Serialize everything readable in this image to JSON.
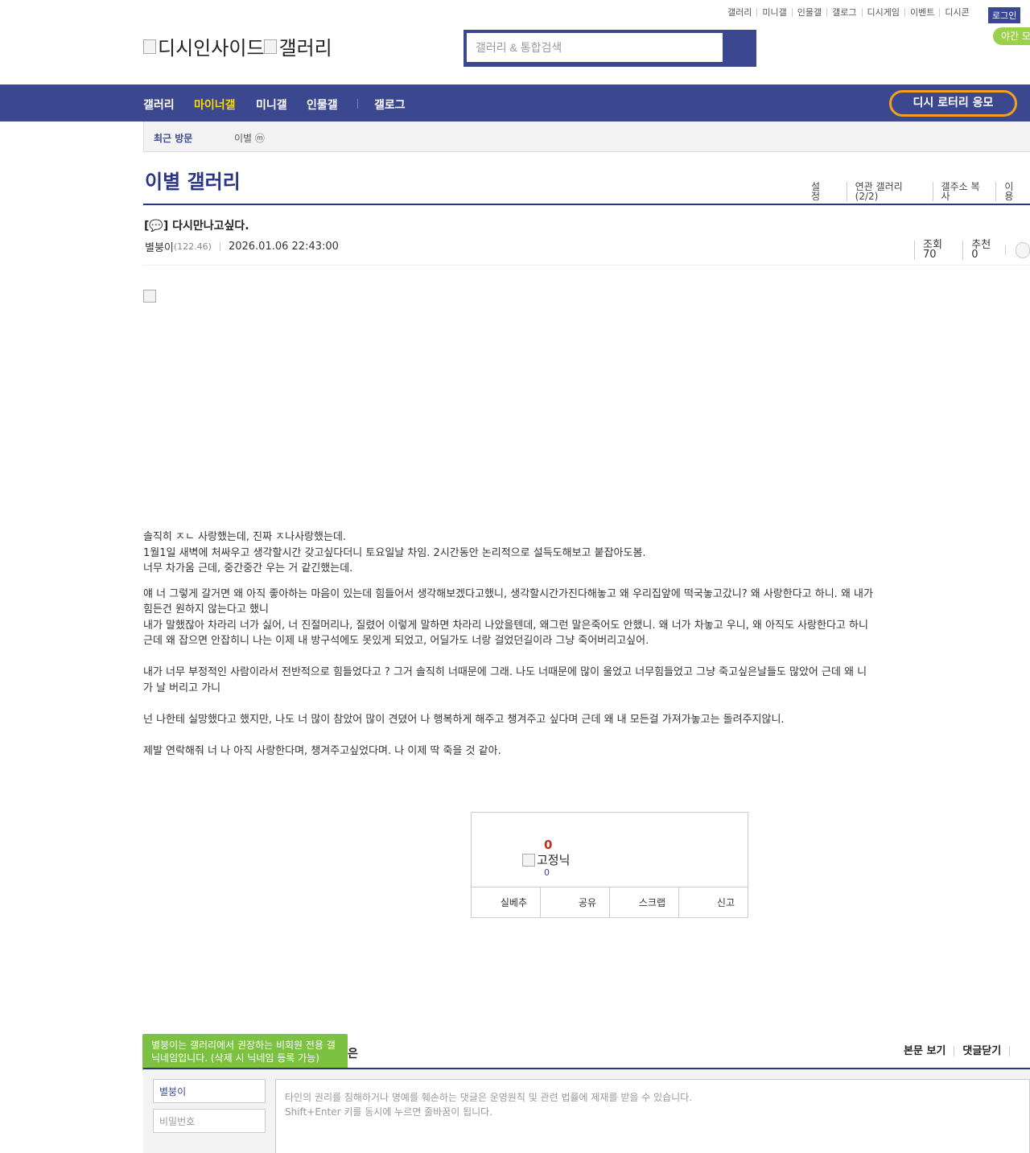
{
  "util_links": [
    "갤러리",
    "미니갤",
    "인물갤",
    "갤로그",
    "디시게임",
    "이벤트",
    "디시콘"
  ],
  "login": "로그인",
  "night_mode": "야간 모",
  "logo": {
    "main": "디시인사이드",
    "sub": "갤러리"
  },
  "search": {
    "placeholder": "갤러리 & 통합검색"
  },
  "nav": {
    "items": [
      "갤러리",
      "마이너갤",
      "미니갤",
      "인물갤",
      "갤로그"
    ],
    "active": "마이너갤",
    "lotto": "디시 로터리 응모"
  },
  "recent": {
    "title": "최근 방문",
    "gallery": "이별 ⓜ"
  },
  "gallery": {
    "title": "이별 갤러리",
    "menu": [
      "설정",
      "연관 갤러리(2/2)",
      "갤주소 복사",
      "이용"
    ]
  },
  "post": {
    "title": "[💬] 다시만나고싶다.",
    "author": "별붕이",
    "ip": "(122.46)",
    "date": "2026.01.06 22:43:00",
    "views": "조회 70",
    "recommends": "추천 0",
    "paragraphs": [
      [
        "솔직히 ㅈㄴ 사랑했는데, 진짜 ㅈ나사랑했는데.",
        "1월1일 새벽에 처싸우고 생각할시간 갖고싶다더니 토요일날 차임. 2시간동안 논리적으로 설득도해보고 붙잡아도봄.",
        "너무 차가움 근데, 중간중간 우는 거 같긴했는데."
      ],
      [
        "얘 너 그렇게 갈거면 왜 아직 좋아하는 마음이 있는데 힘들어서 생각해보겠다고했니, 생각할시간가진다해놓고 왜 우리집앞에 떡국놓고갔니? 왜 사랑한다고 하니. 왜 내가 힘든건 원하지 않는다고 했니",
        "내가 말했잖아 차라리 너가 싫어, 너 진절머리나, 질렸어 이렇게 말하면 차라리 나았을텐데, 왜그런 말은죽어도 안했니. 왜 너가 차놓고 우니, 왜 아직도 사랑한다고 하니 근데 왜 잡으면 안잡히니 나는 이제 내 방구석에도 못있게 되었고, 어딜가도 너랑 걸었던길이라 그냥 죽어버리고싶어."
      ],
      [
        "내가 너무 부정적인 사람이라서 전반적으로 힘들었다고 ? 그거 솔직히 너때문에 그래. 나도 너때문에 많이 울었고 너무힘들었고 그냥 죽고싶은날들도 많았어 근데 왜 니가 날 버리고 가니"
      ],
      [
        "넌 나한테 실망했다고 했지만, 나도 너 많이 참았어 많이 견뎠어 나 행복하게 해주고 챙겨주고 싶다며 근데 왜 내 모든걸 가져가놓고는 돌려주지않니."
      ],
      [
        "제발 연락해줘 너 나 아직 사랑한다며, 챙겨주고싶었다며. 나 이제 딱 죽을 것 같아."
      ]
    ]
  },
  "recommend": {
    "count": "0",
    "fixed_nick_label": "고정닉",
    "fixed_count": "0",
    "buttons": [
      "실베추",
      "공유",
      "스크랩",
      "신고"
    ]
  },
  "comment": {
    "tip": "별붕이는 갤러리에서 권장하는 비회원 전용 갤닉네임입니다. (삭제 시 닉네임 등록 가능)",
    "tip_tail": "은",
    "menu": [
      "본문 보기",
      "댓글닫기",
      ""
    ],
    "nick": "별붕이",
    "password_placeholder": "비밀번호",
    "placeholder_line1": "타인의 권리를 침해하거나 명예를 훼손하는 댓글은 운영원칙 및 관련 법률에 제재를 받을 수 있습니다.",
    "placeholder_line2": "Shift+Enter 키를 동시에 누르면 줄바꿈이 됩니다."
  }
}
